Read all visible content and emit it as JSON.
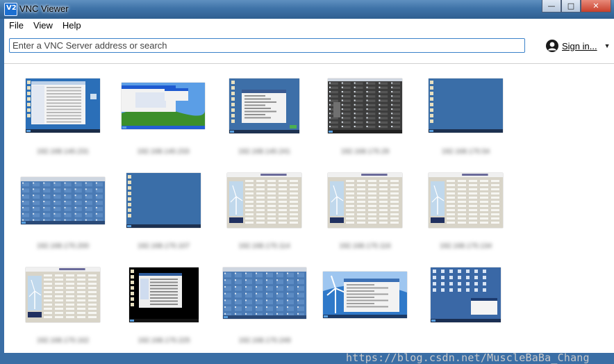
{
  "window": {
    "title": "VNC Viewer",
    "logo": "V2"
  },
  "menu": {
    "items": [
      "File",
      "View",
      "Help"
    ]
  },
  "search": {
    "placeholder": "Enter a VNC Server address or search"
  },
  "account": {
    "label": "Sign in..."
  },
  "watermark": "https://blog.csdn.net/MuscleBaBa_Chang",
  "icons": [
    "app-logo-icon",
    "minimize-icon",
    "maximize-icon",
    "close-icon",
    "user-icon",
    "dropdown-caret-icon"
  ],
  "connections": [
    {
      "label": "192.168.140.231",
      "preview": "win7-explorer-desktop"
    },
    {
      "label": "192.168.140.233",
      "preview": "winxp-green-hills-desktop"
    },
    {
      "label": "192.168.140.241",
      "preview": "blue-desktop-dialog"
    },
    {
      "label": "192.168.170.29",
      "preview": "dark-monitor-grid"
    },
    {
      "label": "192.168.170.54",
      "preview": "blue-desktop-icons"
    },
    {
      "label": "192.168.170.200",
      "preview": "blue-monitor-grid"
    },
    {
      "label": "192.168.170.107",
      "preview": "blue-desktop-icons"
    },
    {
      "label": "192.168.170.114",
      "preview": "turbine-control-panel"
    },
    {
      "label": "192.168.170.116",
      "preview": "turbine-control-panel"
    },
    {
      "label": "192.168.170.134",
      "preview": "turbine-control-panel"
    },
    {
      "label": "192.168.170.162",
      "preview": "turbine-control-panel"
    },
    {
      "label": "192.168.170.225",
      "preview": "black-desktop-window"
    },
    {
      "label": "192.168.170.249",
      "preview": "blue-monitor-grid"
    },
    {
      "label": "",
      "preview": "turbine-desktop-window"
    },
    {
      "label": "",
      "preview": "blue-desktop-popup"
    }
  ]
}
